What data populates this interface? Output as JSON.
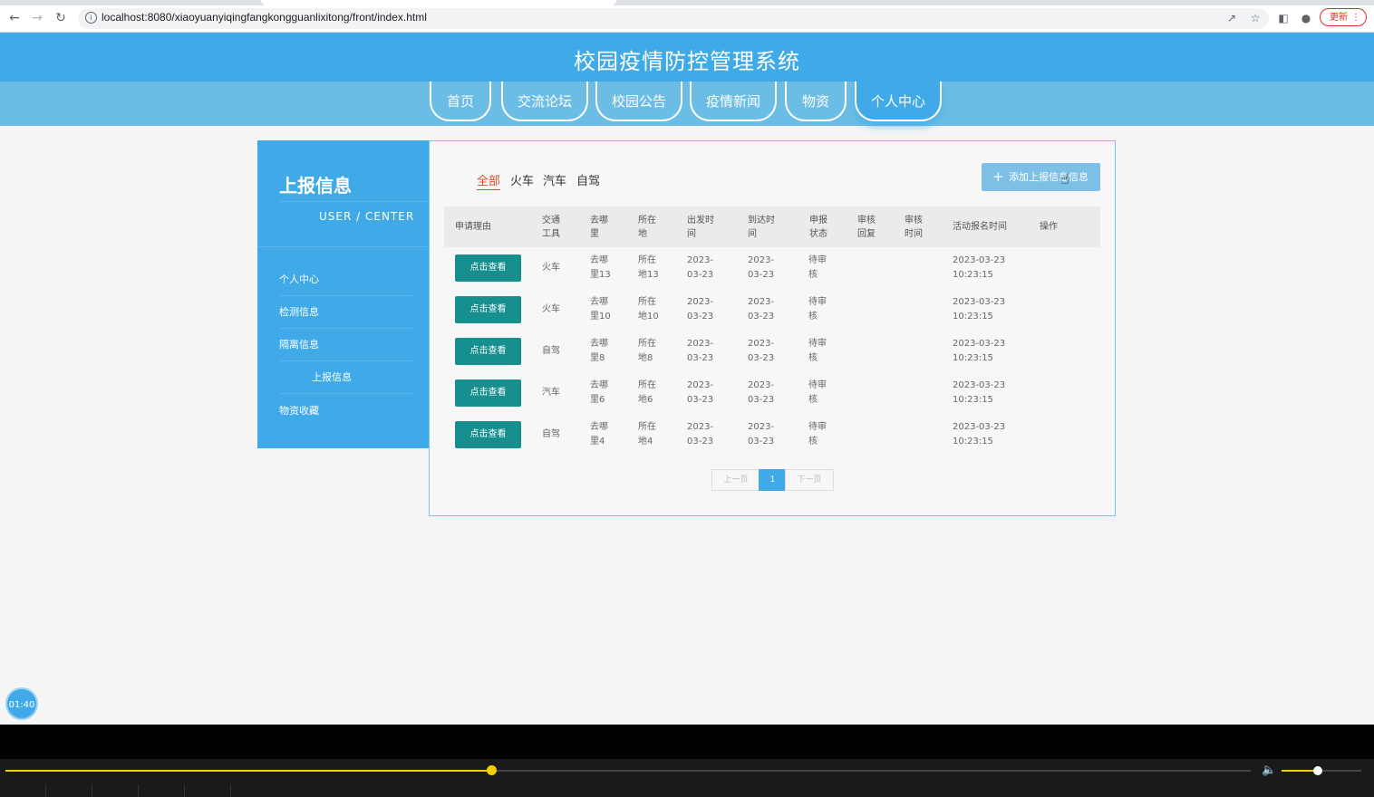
{
  "browser": {
    "url": "localhost:8080/xiaoyuanyiqingfangkongguanlixitong/front/index.html",
    "update_label": "更新"
  },
  "site": {
    "title": "校园疫情防控管理系统",
    "nav": [
      {
        "label": "首页"
      },
      {
        "label": "交流论坛"
      },
      {
        "label": "校园公告"
      },
      {
        "label": "疫情新闻"
      },
      {
        "label": "物资"
      },
      {
        "label": "个人中心",
        "active": true
      }
    ]
  },
  "sidebar": {
    "title": "上报信息",
    "subtitle": "USER / CENTER",
    "items": [
      {
        "label": "个人中心"
      },
      {
        "label": "检测信息"
      },
      {
        "label": "隔离信息"
      },
      {
        "label": "上报信息",
        "active": true
      },
      {
        "label": "物资收藏"
      }
    ]
  },
  "main": {
    "filters": [
      "全部",
      "火车",
      "汽车",
      "自驾"
    ],
    "active_filter": "全部",
    "add_button": "添加上报信息信息",
    "columns": [
      [
        "申请理由"
      ],
      [
        "交通",
        "工具"
      ],
      [
        "去哪",
        "里"
      ],
      [
        "所在",
        "地"
      ],
      [
        "出发时",
        "间"
      ],
      [
        "到达时",
        "间"
      ],
      [
        "申报",
        "状态"
      ],
      [
        "审核",
        "回复"
      ],
      [
        "审核",
        "时间"
      ],
      [
        "活动报名时间"
      ],
      [
        "操作"
      ]
    ],
    "rows": [
      {
        "reason": "点击查看",
        "vehicle": "火车",
        "dest": [
          "去哪",
          "里13"
        ],
        "loc": [
          "所在",
          "地13"
        ],
        "depart": [
          "2023-",
          "03-23"
        ],
        "arrive": [
          "2023-",
          "03-23"
        ],
        "status": [
          "待审",
          "核"
        ],
        "reg": [
          "2023-03-23",
          "10:23:15"
        ]
      },
      {
        "reason": "点击查看",
        "vehicle": "火车",
        "dest": [
          "去哪",
          "里10"
        ],
        "loc": [
          "所在",
          "地10"
        ],
        "depart": [
          "2023-",
          "03-23"
        ],
        "arrive": [
          "2023-",
          "03-23"
        ],
        "status": [
          "待审",
          "核"
        ],
        "reg": [
          "2023-03-23",
          "10:23:15"
        ]
      },
      {
        "reason": "点击查看",
        "vehicle": "自驾",
        "dest": [
          "去哪",
          "里8"
        ],
        "loc": [
          "所在",
          "地8"
        ],
        "depart": [
          "2023-",
          "03-23"
        ],
        "arrive": [
          "2023-",
          "03-23"
        ],
        "status": [
          "待审",
          "核"
        ],
        "reg": [
          "2023-03-23",
          "10:23:15"
        ]
      },
      {
        "reason": "点击查看",
        "vehicle": "汽车",
        "dest": [
          "去哪",
          "里6"
        ],
        "loc": [
          "所在",
          "地6"
        ],
        "depart": [
          "2023-",
          "03-23"
        ],
        "arrive": [
          "2023-",
          "03-23"
        ],
        "status": [
          "待审",
          "核"
        ],
        "reg": [
          "2023-03-23",
          "10:23:15"
        ]
      },
      {
        "reason": "点击查看",
        "vehicle": "自驾",
        "dest": [
          "去哪",
          "里4"
        ],
        "loc": [
          "所在",
          "地4"
        ],
        "depart": [
          "2023-",
          "03-23"
        ],
        "arrive": [
          "2023-",
          "03-23"
        ],
        "status": [
          "待审",
          "核"
        ],
        "reg": [
          "2023-03-23",
          "10:23:15"
        ]
      }
    ],
    "pager": {
      "prev": "上一页",
      "current": "1",
      "next": "下一页"
    }
  },
  "overlay": {
    "timer": "01:40",
    "seek_progress": 0.39,
    "volume_level": 0.45
  }
}
